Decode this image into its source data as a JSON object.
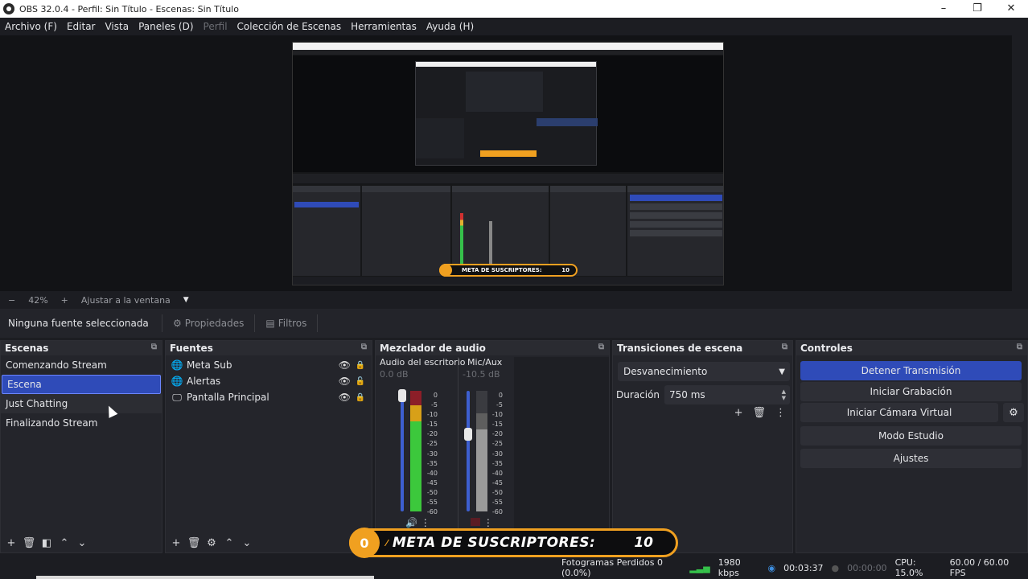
{
  "window": {
    "title": "OBS 32.0.4 - Perfil: Sin Título - Escenas: Sin Título",
    "min": "–",
    "max": "❐",
    "close": "✕"
  },
  "menu": [
    {
      "label": "Archivo (F)",
      "enabled": true
    },
    {
      "label": "Editar",
      "enabled": true
    },
    {
      "label": "Vista",
      "enabled": true
    },
    {
      "label": "Paneles (D)",
      "enabled": true
    },
    {
      "label": "Perfil",
      "enabled": false
    },
    {
      "label": "Colección de Escenas",
      "enabled": true
    },
    {
      "label": "Herramientas",
      "enabled": true
    },
    {
      "label": "Ayuda (H)",
      "enabled": true
    }
  ],
  "preview": {
    "zoom_minus": "−",
    "zoom_level": "42%",
    "zoom_plus": "+",
    "fit_label": "Ajustar a la ventana",
    "fit_arrow": "▼",
    "nested_badge_label": "META DE SUSCRIPTORES:",
    "nested_badge_count": "10"
  },
  "source_toolbar": {
    "no_source": "Ninguna fuente seleccionada",
    "properties": "Propiedades",
    "filters": "Filtros",
    "properties_icon": "gear-icon",
    "filters_icon": "filter-icon"
  },
  "scenes": {
    "title": "Escenas",
    "items": [
      "Comenzando Stream",
      "Escena",
      "Just Chatting",
      "Finalizando Stream"
    ],
    "selected_index": 1
  },
  "sources": {
    "title": "Fuentes",
    "items": [
      {
        "label": "Meta Sub",
        "icon": "browser-icon"
      },
      {
        "label": "Alertas",
        "icon": "browser-icon"
      },
      {
        "label": "Pantalla Principal",
        "icon": "monitor-icon"
      }
    ]
  },
  "mixer": {
    "title": "Mezclador de audio",
    "channels": [
      {
        "name": "Audio del escritorio",
        "db": "0.0 dB",
        "volume": 1.0,
        "peak": 0.9
      },
      {
        "name": "Mic/Aux",
        "db": "-10.5 dB",
        "volume": 0.7,
        "peak": 0.6
      }
    ],
    "scale": [
      "0",
      "-5",
      "-10",
      "-15",
      "-20",
      "-25",
      "-30",
      "-35",
      "-40",
      "-45",
      "-50",
      "-55",
      "-60"
    ]
  },
  "transitions": {
    "title": "Transiciones de escena",
    "selected": "Desvanecimiento",
    "duration_label": "Duración",
    "duration_value": "750 ms"
  },
  "controls": {
    "title": "Controles",
    "buttons": [
      "Detener Transmisión",
      "Iniciar Grabación",
      "Iniciar Cámara Virtual",
      "Modo Estudio",
      "Ajustes"
    ]
  },
  "status": {
    "dropped": "Fotogramas Perdidos 0 (0.0%)",
    "bitrate": "1980 kbps",
    "stream_time": "00:03:37",
    "rec_time": "00:00:00",
    "cpu": "CPU: 15.0%",
    "fps": "60.00 / 60.00 FPS"
  },
  "overlay": {
    "count_circle": "0",
    "label": "META DE SUSCRIPTORES:",
    "count": "10"
  },
  "colors": {
    "accent": "#2f4bb8",
    "badge": "#f0a020"
  }
}
